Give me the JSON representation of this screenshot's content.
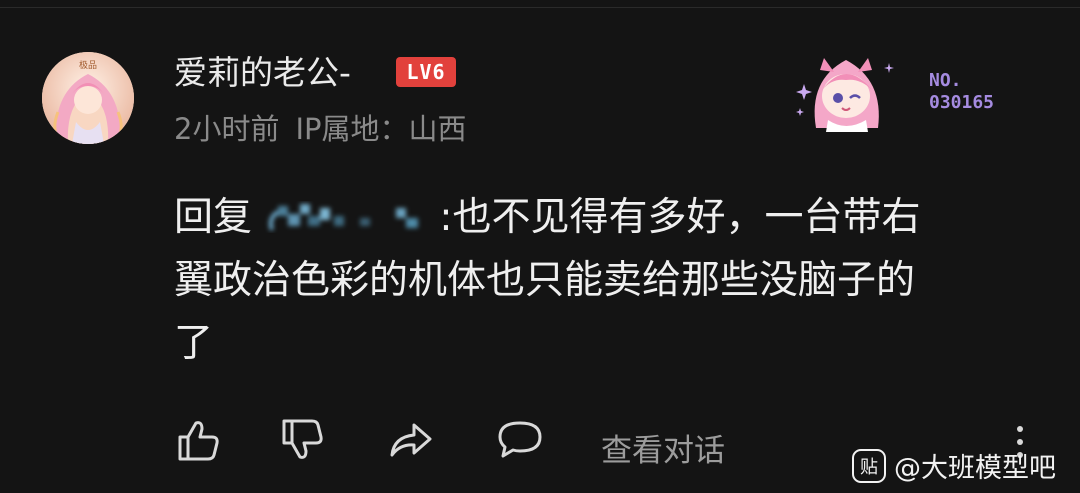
{
  "comment": {
    "user": {
      "name": "爱莉的老公-",
      "level": "LV6",
      "avatar_badge": "极品"
    },
    "meta": {
      "time": "2小时前",
      "ip_location": "IP属地：山西"
    },
    "fan_badge": {
      "number_prefix": "NO.",
      "number": "030165"
    },
    "reply_prefix": "回复",
    "reply_text_line1": ":也不见得有多好，一台带右",
    "reply_text_line2": "翼政治色彩的机体也只能卖给那些没脑子的",
    "reply_text_line3": "了"
  },
  "actions": {
    "view_replies": "查看对话"
  },
  "watermark": {
    "icon_text": "贴",
    "text": "@大班模型吧"
  },
  "colors": {
    "background": "#141414",
    "level_badge": "#e2413c",
    "fan_number": "#a58be0"
  }
}
